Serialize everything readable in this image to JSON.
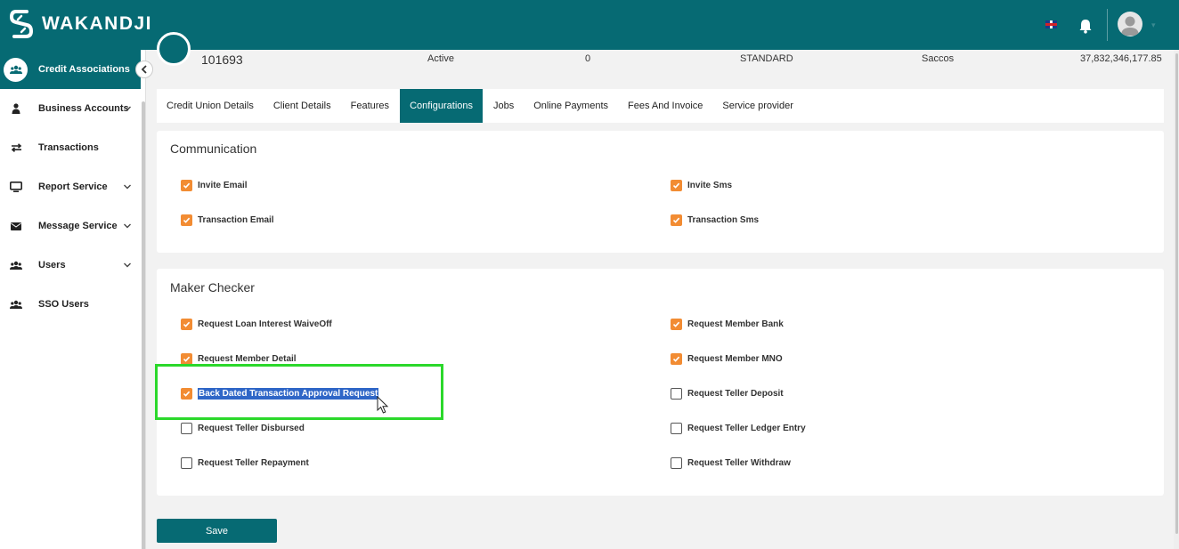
{
  "header": {
    "brand": "WAKANDJI",
    "icons": [
      "wakandji-logo-icon",
      "uk-flag-icon",
      "bell-icon",
      "user-avatar-icon",
      "chevron-down-icon"
    ]
  },
  "sidebar": {
    "items": [
      {
        "label": "Credit Associations",
        "icon": "users-icon",
        "active": true
      },
      {
        "label": "Business Accounts",
        "icon": "user-icon",
        "has_submenu": true
      },
      {
        "label": "Transactions",
        "icon": "exchange-icon"
      },
      {
        "label": "Report Service",
        "icon": "monitor-icon",
        "has_submenu": true
      },
      {
        "label": "Message Service",
        "icon": "envelope-icon",
        "has_submenu": true
      },
      {
        "label": "Users",
        "icon": "users-icon",
        "has_submenu": true
      },
      {
        "label": "SSO Users",
        "icon": "users-icon"
      }
    ]
  },
  "summary": {
    "id": "101693",
    "status": "Active",
    "count": "0",
    "plan": "STANDARD",
    "type": "Saccos",
    "amount": "37,832,346,177.85"
  },
  "tabs": [
    {
      "label": "Credit Union Details"
    },
    {
      "label": "Client Details"
    },
    {
      "label": "Features"
    },
    {
      "label": "Configurations",
      "active": true
    },
    {
      "label": "Jobs"
    },
    {
      "label": "Online Payments"
    },
    {
      "label": "Fees And Invoice"
    },
    {
      "label": "Service provider"
    }
  ],
  "communication": {
    "title": "Communication",
    "items": [
      {
        "label": "Invite Email",
        "checked": true
      },
      {
        "label": "Invite Sms",
        "checked": true
      },
      {
        "label": "Transaction Email",
        "checked": true
      },
      {
        "label": "Transaction Sms",
        "checked": true
      }
    ]
  },
  "maker_checker": {
    "title": "Maker Checker",
    "items": [
      {
        "label": "Request Loan Interest WaiveOff",
        "checked": true
      },
      {
        "label": "Request Member Bank",
        "checked": true
      },
      {
        "label": "Request Member Detail",
        "checked": true
      },
      {
        "label": "Request Member MNO",
        "checked": true
      },
      {
        "label": "Back Dated Transaction Approval Request",
        "checked": true
      },
      {
        "label": "Request Teller Deposit",
        "checked": false
      },
      {
        "label": "Request Teller Disbursed",
        "checked": false
      },
      {
        "label": "Request Teller Ledger Entry",
        "checked": false
      },
      {
        "label": "Request Teller Repayment",
        "checked": false
      },
      {
        "label": "Request Teller Withdraw",
        "checked": false
      }
    ]
  },
  "actions": {
    "save_label": "Save"
  },
  "colors": {
    "primary": "#066a73",
    "checkbox_checked": "#f28c33",
    "highlight": "#2bd82b",
    "selection": "#2f66c7"
  }
}
